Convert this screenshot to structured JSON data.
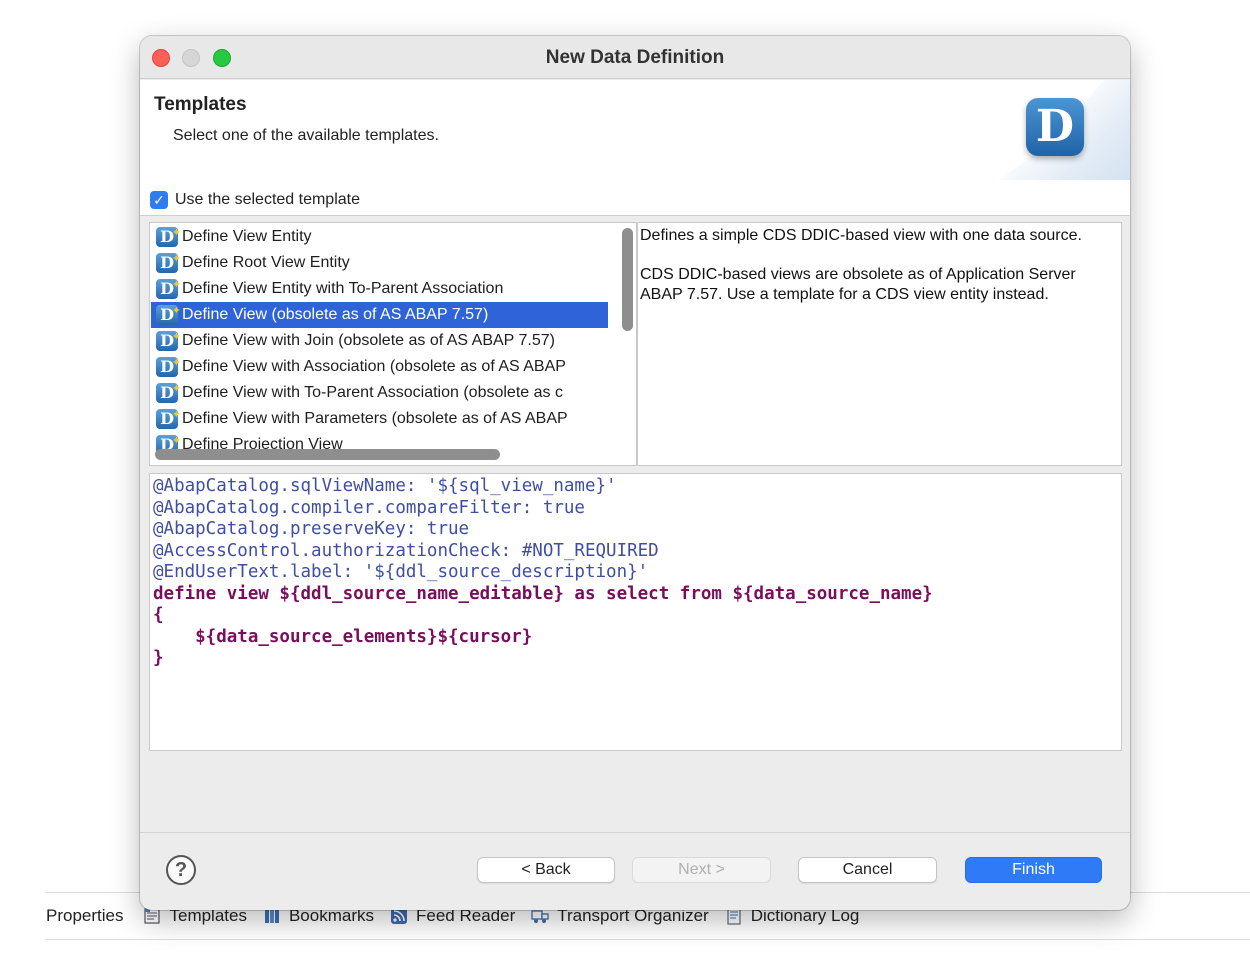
{
  "dialog": {
    "title": "New Data Definition",
    "header": {
      "title": "Templates",
      "subtitle": "Select one of the available templates.",
      "logo_icon": "ddic-d-logo-icon"
    },
    "use_template_label": "Use the selected template",
    "use_template_checked": true,
    "templates": [
      {
        "label": "Define View Entity",
        "selected": false
      },
      {
        "label": "Define Root View Entity",
        "selected": false
      },
      {
        "label": "Define View Entity with To-Parent Association",
        "selected": false
      },
      {
        "label": "Define View (obsolete as of AS ABAP 7.57)",
        "selected": true
      },
      {
        "label": "Define View with Join (obsolete as of AS ABAP 7.57)",
        "selected": false
      },
      {
        "label": "Define View with Association (obsolete as of AS ABAP",
        "selected": false
      },
      {
        "label": "Define View with To-Parent Association (obsolete as c",
        "selected": false
      },
      {
        "label": "Define View with Parameters (obsolete as of AS ABAP",
        "selected": false
      },
      {
        "label": "Define Projection View",
        "selected": false
      }
    ],
    "description": [
      "Defines a simple CDS DDIC-based view with one data source.",
      "CDS DDIC-based views are obsolete as of Application Server ABAP 7.57. Use a template for a CDS view entity instead."
    ],
    "code_lines": [
      {
        "text": "@AbapCatalog.sqlViewName: '${sql_view_name}'",
        "kind": "ann"
      },
      {
        "text": "@AbapCatalog.compiler.compareFilter: true",
        "kind": "ann"
      },
      {
        "text": "@AbapCatalog.preserveKey: true",
        "kind": "ann"
      },
      {
        "text": "@AccessControl.authorizationCheck: #NOT_REQUIRED",
        "kind": "ann"
      },
      {
        "text": "@EndUserText.label: '${ddl_source_description}'",
        "kind": "ann"
      },
      {
        "text": "define view ${ddl_source_name_editable} as select from ${data_source_name}",
        "kind": "kw"
      },
      {
        "text": "{",
        "kind": "kw"
      },
      {
        "text": "    ${data_source_elements}${cursor}",
        "kind": "kw"
      },
      {
        "text": "}",
        "kind": "kw"
      }
    ],
    "buttons": {
      "help": "?",
      "back": "< Back",
      "next": "Next >",
      "cancel": "Cancel",
      "finish": "Finish"
    }
  },
  "bottom_bar": {
    "items": [
      {
        "label": "Properties",
        "icon": ""
      },
      {
        "label": "Templates",
        "icon": "templates-icon"
      },
      {
        "label": "Bookmarks",
        "icon": "bookmarks-icon"
      },
      {
        "label": "Feed Reader",
        "icon": "feed-reader-icon"
      },
      {
        "label": "Transport Organizer",
        "icon": "transport-organizer-icon"
      },
      {
        "label": "Dictionary Log",
        "icon": "dictionary-log-icon"
      }
    ]
  }
}
